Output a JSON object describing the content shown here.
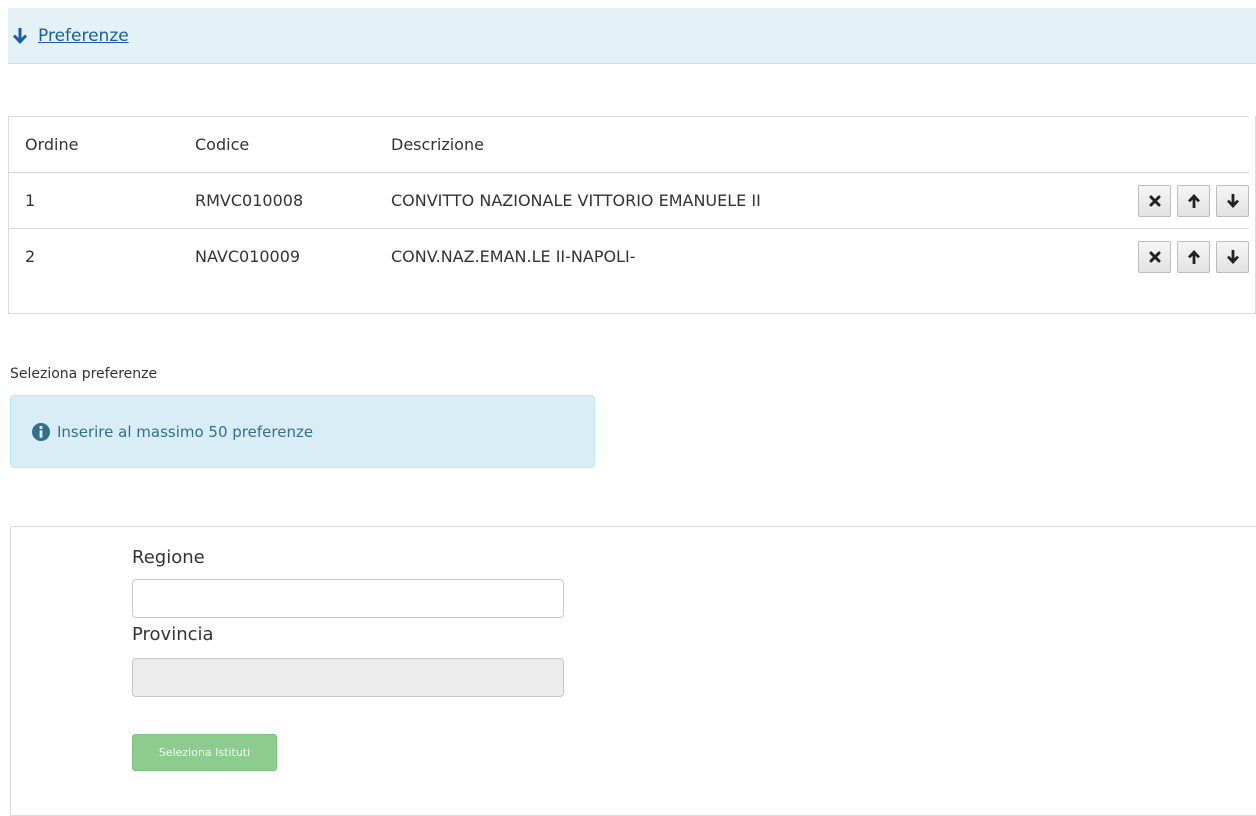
{
  "header": {
    "title": "Preferenze",
    "icon": "arrow-down-icon"
  },
  "table": {
    "columns": [
      "Ordine",
      "Codice",
      "Descrizione"
    ],
    "rows": [
      {
        "ordine": "1",
        "codice": "RMVC010008",
        "descrizione": "CONVITTO NAZIONALE VITTORIO EMANUELE II"
      },
      {
        "ordine": "2",
        "codice": "NAVC010009",
        "descrizione": "CONV.NAZ.EMAN.LE II-NAPOLI-"
      }
    ],
    "row_actions": [
      "remove-icon",
      "move-up-icon",
      "move-down-icon"
    ]
  },
  "selection": {
    "label": "Seleziona preferenze",
    "info_text": "Inserire al massimo 50 preferenze",
    "info_icon": "info-circle-icon"
  },
  "form": {
    "regione_label": "Regione",
    "regione_value": "",
    "provincia_label": "Provincia",
    "provincia_value": "",
    "submit_label": "Seleziona Istituti"
  },
  "colors": {
    "header_bg": "#e4f2f8",
    "link": "#1a5dab",
    "info_bg": "#d9edf7",
    "info_text": "#31708f",
    "submit_bg": "#8ccc8f"
  }
}
